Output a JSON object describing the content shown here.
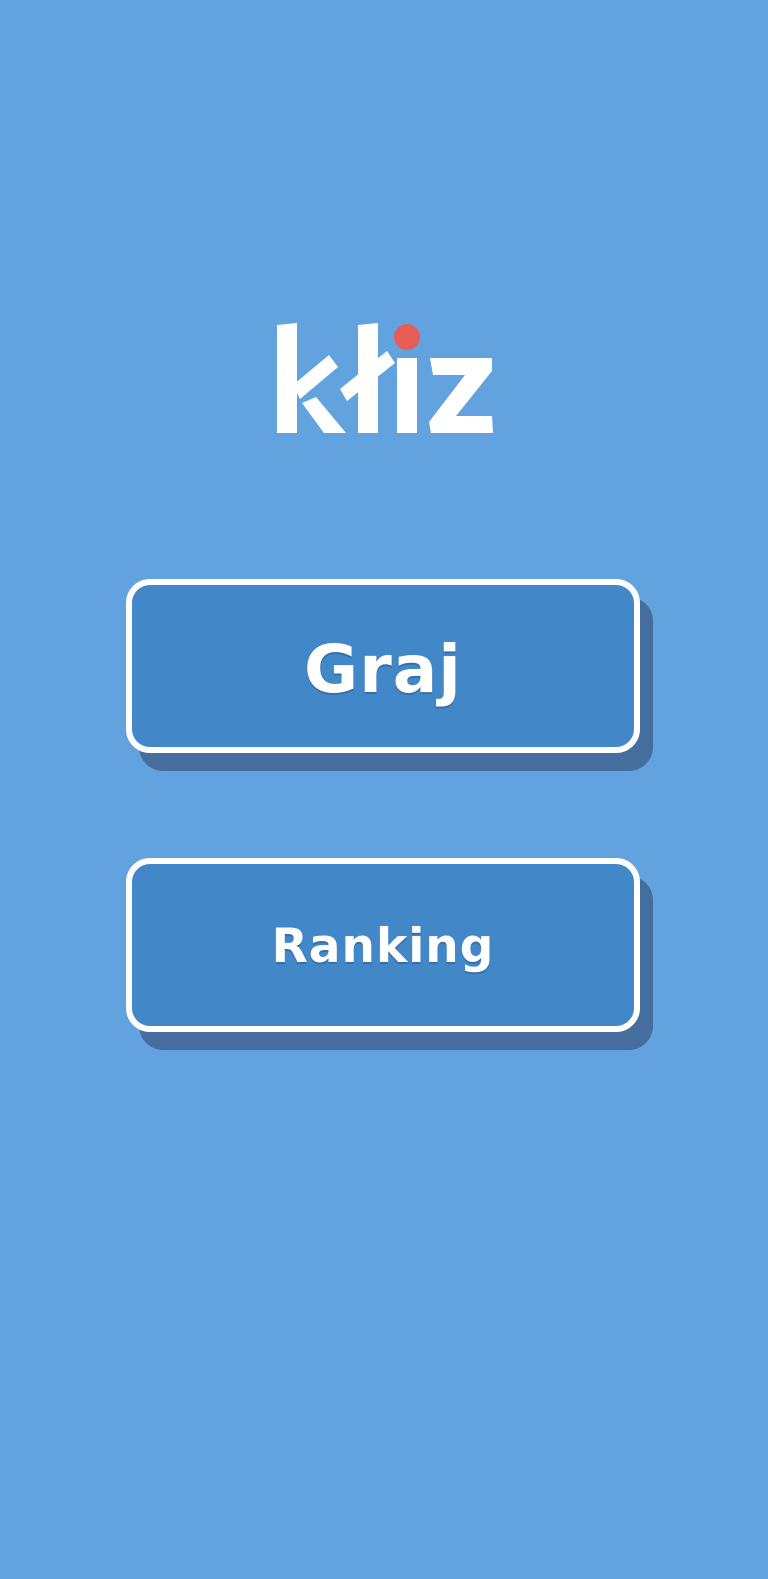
{
  "app": {
    "logo_text": "kłiz",
    "background_color": "#62A3DF",
    "accent_dot_color": "#E85C58"
  },
  "menu": {
    "play_label": "Graj",
    "ranking_label": "Ranking",
    "button_fill_color": "#4287C8",
    "button_border_color": "#FFFFFF"
  }
}
